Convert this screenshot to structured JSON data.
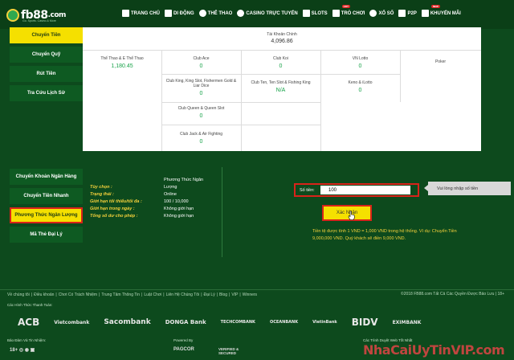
{
  "brand": {
    "logo_text": "fb88",
    "logo_suffix": ".com",
    "tagline": "Go. Sports. Casino & More"
  },
  "nav": {
    "items": [
      {
        "label": "TRANG CHỦ",
        "icon": "home-icon"
      },
      {
        "label": "DI ĐỘNG",
        "icon": "mobile-icon"
      },
      {
        "label": "THỂ THAO",
        "icon": "soccer-ball-icon"
      },
      {
        "label": "CASINO TRỰC TUYẾN",
        "icon": "casino-chip-icon"
      },
      {
        "label": "SLOTS",
        "icon": "slot-machine-icon"
      },
      {
        "label": "TRÒ CHƠI",
        "icon": "gamepad-icon",
        "badge": "HOT"
      },
      {
        "label": "XỔ SỐ",
        "icon": "lottery-ball-icon"
      },
      {
        "label": "P2P",
        "icon": "cards-icon"
      },
      {
        "label": "KHUYẾN MÃI",
        "icon": "gift-icon",
        "badge": "NEW"
      }
    ]
  },
  "top_sidebar": {
    "items": [
      "Chuyển Tiền",
      "Chuyển Quỹ",
      "Rút Tiền",
      "Tra Cứu Lịch Sử"
    ],
    "active": 0
  },
  "balance": {
    "main_label": "Tài Khoản Chính",
    "main_value": "4,096.86",
    "cells": [
      {
        "label": "Thể Thao & E Thể Thao",
        "value": "1,180.45"
      },
      {
        "label": "Club Ace",
        "value": "0"
      },
      {
        "label": "Club Koi",
        "value": "0"
      },
      {
        "label": "VN Lotto",
        "value": "0"
      },
      {
        "label": "Poker",
        "value": ""
      },
      {
        "label": "Club King, King Slot, Fishermen Gold & Liar Dice",
        "value": "0"
      },
      {
        "label": "Club Ten, Ten Slot & Fishing King",
        "value": "N/A"
      },
      {
        "label": "Keno & iLotto",
        "value": "0"
      },
      {
        "label": "Club Queen & Queen Slot",
        "value": "0"
      },
      {
        "label": "Club Jack & Air Fighting",
        "value": "0"
      }
    ]
  },
  "method_sidebar": {
    "items": [
      "Chuyển Khoản Ngân Hàng",
      "Chuyển Tiền Nhanh",
      "Phương Thức Ngân Lượng",
      "Mã Thẻ Đại Lý"
    ],
    "active": 2
  },
  "details": {
    "header": "Phương Thức Ngân",
    "rows": [
      {
        "label": "Tùy chọn :",
        "value": "Lượng"
      },
      {
        "label": "Trạng thái :",
        "value": "Online"
      },
      {
        "label": "Giới hạn tối thiểu/tối đa :",
        "value": "100 / 10,000"
      },
      {
        "label": "Giới hạn trong ngày :",
        "value": "Không giới hạn"
      },
      {
        "label": "Tổng số dư cho phép :",
        "value": "Không giới hạn"
      }
    ]
  },
  "form": {
    "amount_label": "Số tiền:",
    "amount_value": "100",
    "tooltip": "Vui lòng nhập số tiền",
    "confirm_label": "Xác Nhận",
    "note": "Tiền tệ được tính 1 VND = 1,000 VND trong hệ thống. Ví dụ: Chuyển Tiền 9,000,000 VND. Quý khách sẽ điền 9,000 VND."
  },
  "footer": {
    "links": [
      "Về chúng tôi",
      "Điều khoản",
      "Chơi Có Trách Nhiệm",
      "Trung Tâm Thông Tin",
      "Luật Chơi",
      "Liên Hệ Chúng Tôi",
      "Đại Lý",
      "Blog",
      "VIP",
      "Winners"
    ],
    "copyright": "©2018 FB88.com Tất Cả Các Quyền Được Bảo Lưu | 18+",
    "payments_title": "Các Hình Thức Thanh Toán:",
    "banks": [
      "ACB",
      "Vietcombank",
      "Sacombank",
      "DONGA Bank",
      "TECHCOMBANK",
      "OCEANBANK",
      "VietinBank",
      "BIDV",
      "EXIMBANK"
    ],
    "security_title": "Bảo Đảm Và Tin Nhiệm:",
    "powered_title": "Powered By",
    "powered_items": [
      "PAGCOR",
      "VERIFIED & SECURED"
    ],
    "browsers_title": "Các Trình Duyệt Web Tốt Nhất",
    "watermark": "NhaCaiUyTinVIP.com"
  },
  "colors": {
    "bg": "#0d4a1d",
    "accent": "#f5e000",
    "highlight": "#d9231a",
    "value_green": "#19a34a"
  }
}
